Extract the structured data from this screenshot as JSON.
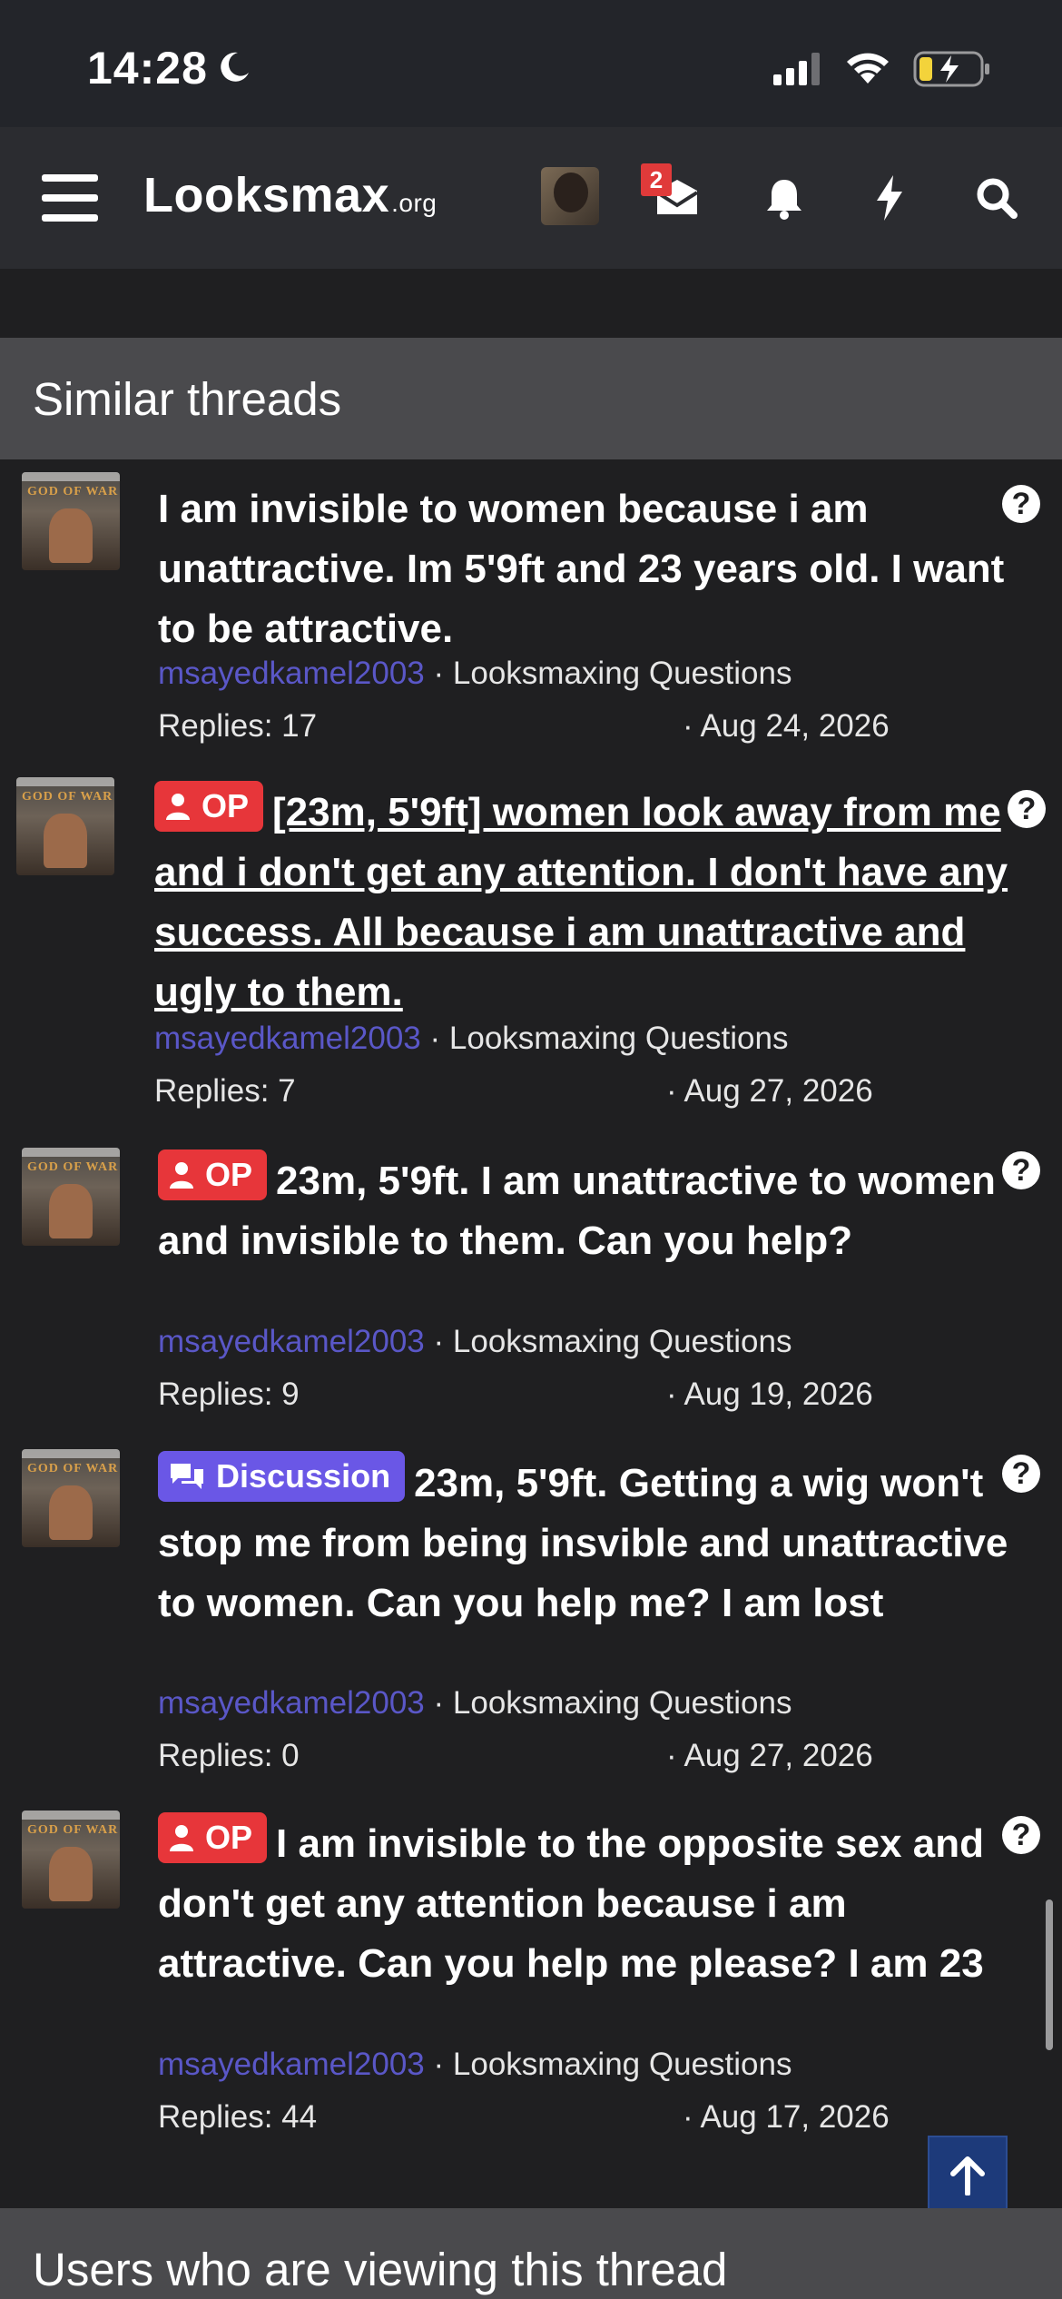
{
  "status_bar": {
    "time": "14:28"
  },
  "nav": {
    "logo_main": "Looksmax",
    "logo_suffix": ".org",
    "inbox_badge": "2"
  },
  "section_title": "Similar threads",
  "threads": [
    {
      "prefix": "",
      "title": "I am invisible to women because i am unattractive. Im 5'9ft and 23 years old. I want to be attractive.",
      "author": "msayedkamel2003",
      "forum": "Looksmaxing Questions",
      "replies": "Replies: 17",
      "date": "Aug 24, 2026"
    },
    {
      "prefix": "OP",
      "title": "[23m, 5'9ft] women look away from me and i don't get any attention. I don't have any success. All because i am unattractive and ugly to them.",
      "author": "msayedkamel2003",
      "forum": "Looksmaxing Questions",
      "replies": "Replies: 7",
      "date": "Aug 27, 2026"
    },
    {
      "prefix": "OP",
      "title": "23m, 5'9ft. I am unattractive to women and invisible to them. Can you help?",
      "author": "msayedkamel2003",
      "forum": "Looksmaxing Questions",
      "replies": "Replies: 9",
      "date": "Aug 19, 2026"
    },
    {
      "prefix": "Discussion",
      "title": "23m, 5'9ft. Getting a wig won't stop me from being insvible and unattractive to women. Can you help me? I am lost",
      "author": "msayedkamel2003",
      "forum": "Looksmaxing Questions",
      "replies": "Replies: 0",
      "date": "Aug 27, 2026"
    },
    {
      "prefix": "OP",
      "title": "I am invisible to the opposite sex and don't get any attention because i am attractive. Can you help me please? I am 23",
      "author": "msayedkamel2003",
      "forum": "Looksmaxing Questions",
      "replies": "Replies: 44",
      "date": "Aug 17, 2026"
    }
  ],
  "thumb_text": "GOD OF WAR",
  "help_glyph": "?",
  "meta_sep": "·",
  "bottom_section_title": "Users who are viewing this thread",
  "colors": {
    "page_bg": "#1f1f21",
    "header_bg": "#4a4a4d",
    "author_link": "#5a57c7",
    "op_label": "#e7363a",
    "discussion_label": "#6a57e6",
    "scroll_top_button": "#1d3a7a"
  }
}
